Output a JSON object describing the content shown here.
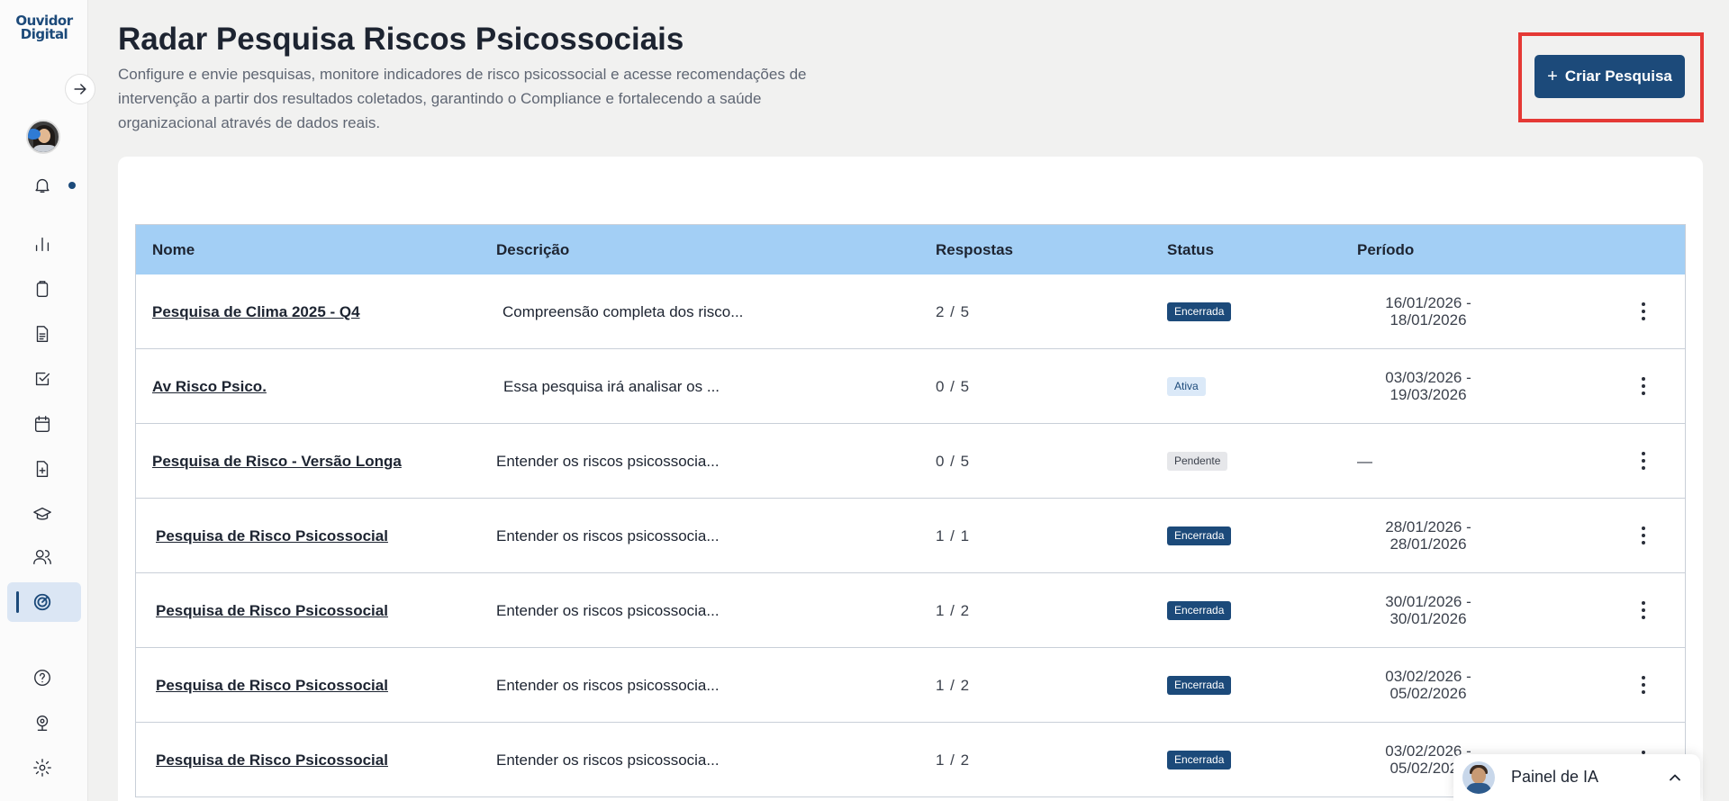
{
  "sidebar": {
    "logo_line1": "Ouvidor",
    "logo_line2": "Digital"
  },
  "header": {
    "title": "Radar Pesquisa Riscos Psicossociais",
    "description": "Configure e envie pesquisas, monitore indicadores de risco psicossocial e acesse recomendações de intervenção a partir dos resultados coletados, garantindo o Compliance e fortalecendo a saúde organizacional através de dados reais.",
    "create_button_plus": "+",
    "create_button_label": "Criar Pesquisa"
  },
  "table": {
    "columns": {
      "nome": "Nome",
      "descricao": "Descrição",
      "respostas": "Respostas",
      "status": "Status",
      "periodo": "Período"
    },
    "rows": [
      {
        "nome": "Pesquisa de Clima 2025 - Q4",
        "descricao": "Compreensão completa dos risco...",
        "respostas": "2 / 5",
        "status": "Encerrada",
        "periodo_inicio": "16/01/2026 -",
        "periodo_fim": "18/01/2026"
      },
      {
        "nome": "Av Risco Psico.",
        "descricao": "Essa pesquisa irá analisar os ...",
        "respostas": "0 / 5",
        "status": "Ativa",
        "periodo_inicio": "03/03/2026 -",
        "periodo_fim": "19/03/2026"
      },
      {
        "nome": "Pesquisa de Risco - Versão Longa",
        "descricao": "Entender os riscos psicossocia...",
        "respostas": "0 / 5",
        "status": "Pendente",
        "periodo_inicio": "—",
        "periodo_fim": ""
      },
      {
        "nome": "Pesquisa de Risco Psicossocial",
        "descricao": "Entender os riscos psicossocia...",
        "respostas": "1 / 1",
        "status": "Encerrada",
        "periodo_inicio": "28/01/2026 -",
        "periodo_fim": "28/01/2026"
      },
      {
        "nome": "Pesquisa de Risco Psicossocial",
        "descricao": "Entender os riscos psicossocia...",
        "respostas": "1 / 2",
        "status": "Encerrada",
        "periodo_inicio": "30/01/2026 -",
        "periodo_fim": "30/01/2026"
      },
      {
        "nome": "Pesquisa de Risco Psicossocial",
        "descricao": "Entender os riscos psicossocia...",
        "respostas": "1 / 2",
        "status": "Encerrada",
        "periodo_inicio": "03/02/2026 -",
        "periodo_fim": "05/02/2026"
      },
      {
        "nome": "Pesquisa de Risco Psicossocial",
        "descricao": "Entender os riscos psicossocia...",
        "respostas": "1 / 2",
        "status": "Encerrada",
        "periodo_inicio": "03/02/2026 -",
        "periodo_fim": "05/02/2026"
      }
    ]
  },
  "ai_panel": {
    "label": "Painel de IA"
  },
  "colors": {
    "primary": "#1c4a7a",
    "table_header": "#a3cff5",
    "highlight": "#e53935"
  }
}
